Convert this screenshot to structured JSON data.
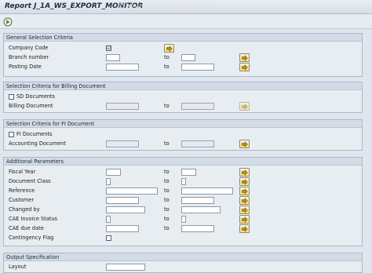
{
  "window": {
    "title": "Report J_1A_WS_EXPORT_MONITOR",
    "watermark": "© www.tutorialkart.com"
  },
  "toolbar": {
    "execute_icon": "execute-icon"
  },
  "general": {
    "title": "General Selection Criteria",
    "company_code": "Company Code",
    "branch_number": "Branch number",
    "posting_date": "Posting Date",
    "company_code_checked": "☑"
  },
  "billing": {
    "title": "Selection Criteria for Billing Document",
    "sd_documents": "SD Documents",
    "billing_document": "Billing Document"
  },
  "fi": {
    "title": "Selection Criteria for FI Document",
    "fi_documents": "FI Documents",
    "accounting_document": "Accounting Document"
  },
  "additional": {
    "title": "Additional Parameters",
    "fiscal_year": "Fiscal Year",
    "document_class": "Document Class",
    "reference": "Reference",
    "customer": "Customer",
    "changed_by": "Changed by",
    "cae_invoice_status": "CAE Invoice Status",
    "cae_due_date": "CAE due date",
    "contingency_flag": "Contingency Flag"
  },
  "output": {
    "title": "Output Specification",
    "layout": "Layout"
  },
  "labels": {
    "to": "to"
  }
}
